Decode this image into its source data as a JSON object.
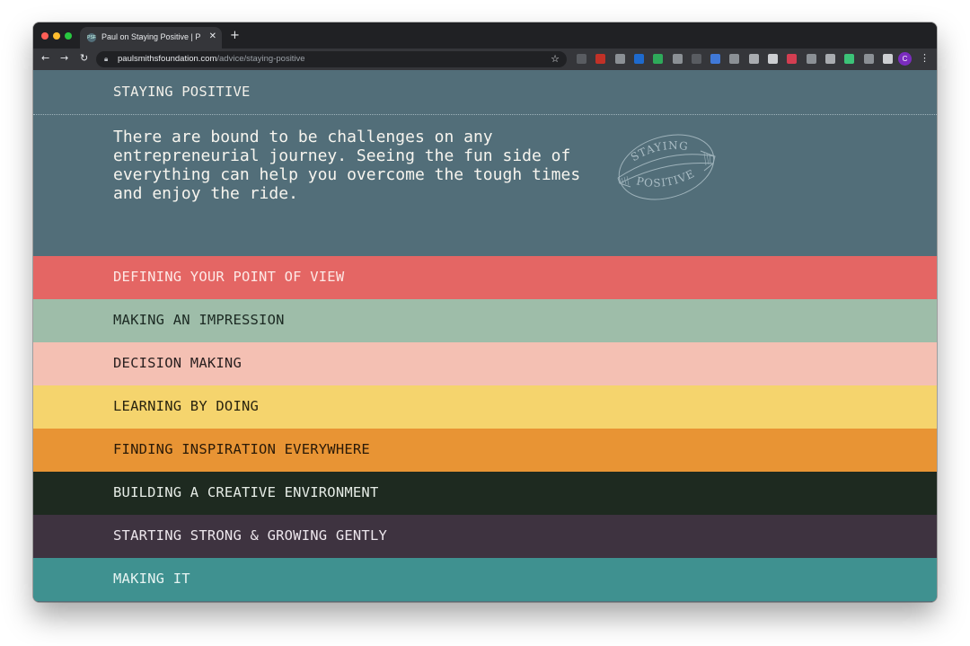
{
  "browser": {
    "tab_title": "Paul on Staying Positive | Paul",
    "tab_favicon": "PSF",
    "url_host": "paulsmithsfoundation.com",
    "url_path": "/advice/staying-positive",
    "profile_initial": "C",
    "new_tab_glyph": "+",
    "close_glyph": "✕"
  },
  "page": {
    "section_title": "STAYING POSITIVE",
    "intro_text": "There are bound to be challenges on any entrepreneurial journey. Seeing the fun side of everything can help you overcome the tough times and enjoy the ride.",
    "stamp_top": "STAYING",
    "stamp_bottom": "POSITIVE",
    "background_color": "#526e79"
  },
  "topics": [
    {
      "label": "DEFINING YOUR POINT OF VIEW",
      "bg": "#e46664",
      "fg": "#fde9e6"
    },
    {
      "label": "MAKING AN IMPRESSION",
      "bg": "#9ebda9",
      "fg": "#1c2a23"
    },
    {
      "label": "DECISION MAKING",
      "bg": "#f4c0b3",
      "fg": "#2a2020"
    },
    {
      "label": "LEARNING BY DOING",
      "bg": "#f5d46d",
      "fg": "#2a2410"
    },
    {
      "label": "FINDING INSPIRATION EVERYWHERE",
      "bg": "#e89434",
      "fg": "#2a1a08"
    },
    {
      "label": "BUILDING A CREATIVE ENVIRONMENT",
      "bg": "#1e2a20",
      "fg": "#e6ece6"
    },
    {
      "label": "STARTING STRONG & GROWING GENTLY",
      "bg": "#3e3340",
      "fg": "#ece6ec"
    },
    {
      "label": "MAKING IT",
      "bg": "#3f9190",
      "fg": "#e6f4f2"
    }
  ],
  "extensions": [
    {
      "name": "screenshot-ext-icon",
      "color": "#5f6368"
    },
    {
      "name": "adblock-ext-icon",
      "color": "#d93025"
    },
    {
      "name": "camera-ext-icon",
      "color": "#9aa0a6"
    },
    {
      "name": "bank-ext-icon",
      "color": "#1a73e8"
    },
    {
      "name": "evernote-ext-icon",
      "color": "#2dbe60"
    },
    {
      "name": "chat-ext-icon",
      "color": "#9aa0a6"
    },
    {
      "name": "new-ext-icon",
      "color": "#5f6368"
    },
    {
      "name": "n-ext-icon",
      "color": "#4285f4"
    },
    {
      "name": "dots-ext-icon",
      "color": "#9aa0a6"
    },
    {
      "name": "webstore-ext-icon",
      "color": "#bdc1c6"
    },
    {
      "name": "reader-ext-icon",
      "color": "#e8eaed"
    },
    {
      "name": "pocket-ext-icon",
      "color": "#ef4056"
    },
    {
      "name": "gauge-ext-icon",
      "color": "#9aa0a6"
    },
    {
      "name": "keyboard-ext-icon",
      "color": "#bdc1c6"
    },
    {
      "name": "notion-ext-icon",
      "color": "#3ddc84"
    },
    {
      "name": "grid-ext-icon",
      "color": "#9aa0a6"
    },
    {
      "name": "puzzle-ext-icon",
      "color": "#e8eaed"
    }
  ]
}
